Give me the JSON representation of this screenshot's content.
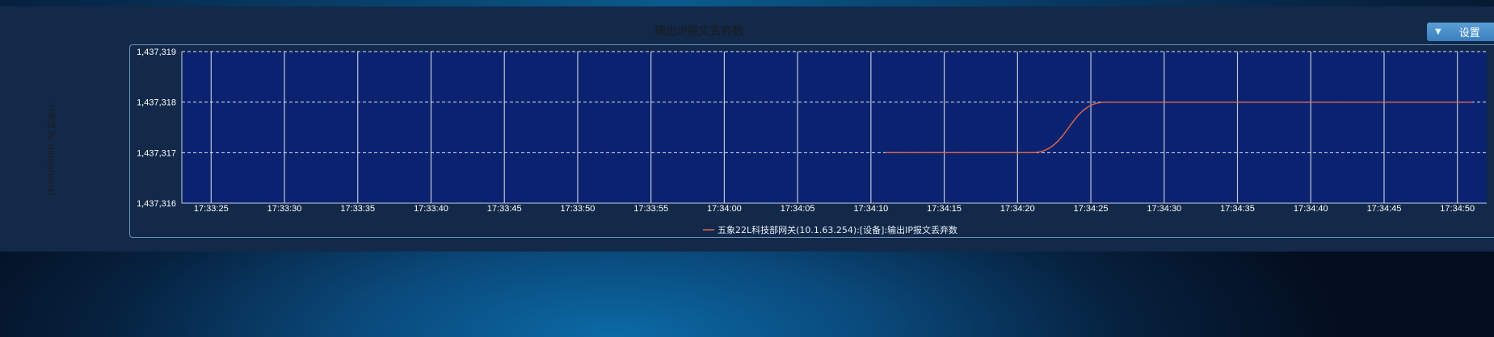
{
  "page": {
    "settings_label": "设置"
  },
  "chart_data": {
    "type": "line",
    "title": "输出IP报文丢弃数",
    "xlabel": "",
    "ylabel": "Y(单位为: datagrams)",
    "x_ticks": [
      "17:33:25",
      "17:33:30",
      "17:33:35",
      "17:33:40",
      "17:33:45",
      "17:33:50",
      "17:33:55",
      "17:34:00",
      "17:34:05",
      "17:34:10",
      "17:34:15",
      "17:34:20",
      "17:34:25",
      "17:34:30",
      "17:34:35",
      "17:34:40",
      "17:34:45",
      "17:34:50"
    ],
    "y_ticks": [
      "1,437,316",
      "1,437,317",
      "1,437,318",
      "1,437,319"
    ],
    "xlim": [
      "17:33:23",
      "17:34:52"
    ],
    "ylim": [
      1437316,
      1437319
    ],
    "grid": true,
    "legend_position": "bottom-center",
    "series": [
      {
        "name": "五象22L科技部网关(10.1.63.254):[设备]:输出IP报文丢弃数",
        "color": "#e0694a",
        "points": [
          [
            "17:34:11",
            1437317
          ],
          [
            "17:34:21",
            1437317
          ],
          [
            "17:34:26",
            1437318
          ],
          [
            "17:34:51",
            1437318
          ]
        ]
      }
    ],
    "colors": {
      "plot_background": "#0a2270",
      "grid": "#dfe6ef",
      "tick_text": "#ffffff"
    }
  }
}
